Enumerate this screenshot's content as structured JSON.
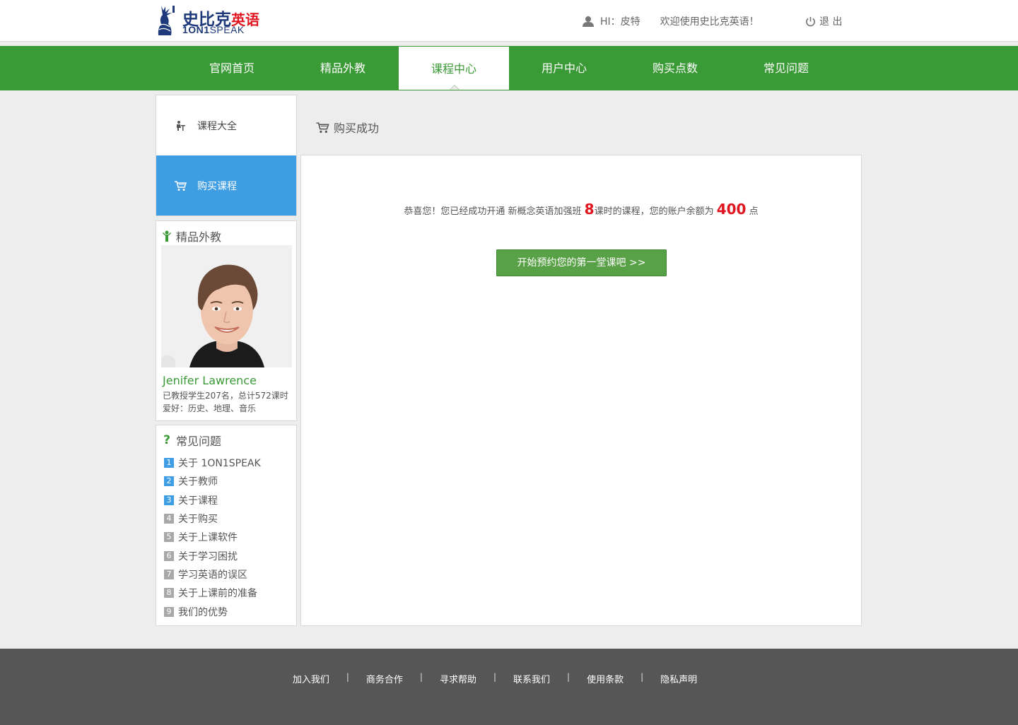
{
  "header": {
    "logo_cn": "史比克",
    "logo_cn_red": "英语",
    "logo_en_bold": "1ON1",
    "logo_en_thin": "SPEAK",
    "greeting": "HI：皮特",
    "welcome": "欢迎使用史比克英语！",
    "logout_label": "退 出"
  },
  "nav": {
    "items": [
      {
        "label": "官网首页"
      },
      {
        "label": "精品外教"
      },
      {
        "label": "课程中心"
      },
      {
        "label": "用户中心"
      },
      {
        "label": "购买点数"
      },
      {
        "label": "常见问题"
      }
    ],
    "active_index": 2
  },
  "sidebar": {
    "menu": [
      {
        "label": "课程大全",
        "icon": "desk-icon"
      },
      {
        "label": "购买课程",
        "icon": "cart-icon"
      }
    ],
    "teacher": {
      "title": "精品外教",
      "name": "Jenifer Lawrence",
      "stats": "已教授学生207名，总计572课时",
      "hobby": "爱好：历史、地理、音乐"
    },
    "faq": {
      "title": "常见问题",
      "items": [
        {
          "num": "1",
          "label": "关于 1ON1SPEAK"
        },
        {
          "num": "2",
          "label": "关于教师"
        },
        {
          "num": "3",
          "label": "关于课程"
        },
        {
          "num": "4",
          "label": "关于购买"
        },
        {
          "num": "5",
          "label": "关于上课软件"
        },
        {
          "num": "6",
          "label": "关于学习困扰"
        },
        {
          "num": "7",
          "label": "学习英语的误区"
        },
        {
          "num": "8",
          "label": "关于上课前的准备"
        },
        {
          "num": "9",
          "label": "我们的优势"
        }
      ]
    }
  },
  "main": {
    "crumb": "购买成功",
    "msg_part1": "恭喜您！您已经成功开通 新概念英语加强班 ",
    "hours": "8",
    "msg_part2": "课时的课程，您的账户余额为 ",
    "balance": "400",
    "msg_part3": " 点",
    "cta_label": "开始预约您的第一堂课吧 >>"
  },
  "footer": {
    "links": [
      "加入我们",
      "商务合作",
      "寻求帮助",
      "联系我们",
      "使用条款",
      "隐私声明"
    ]
  },
  "colors": {
    "brand_green": "#3a9a35",
    "active_blue": "#3f9ee3",
    "highlight_red": "#e0141e",
    "footer_bg": "#565656"
  }
}
